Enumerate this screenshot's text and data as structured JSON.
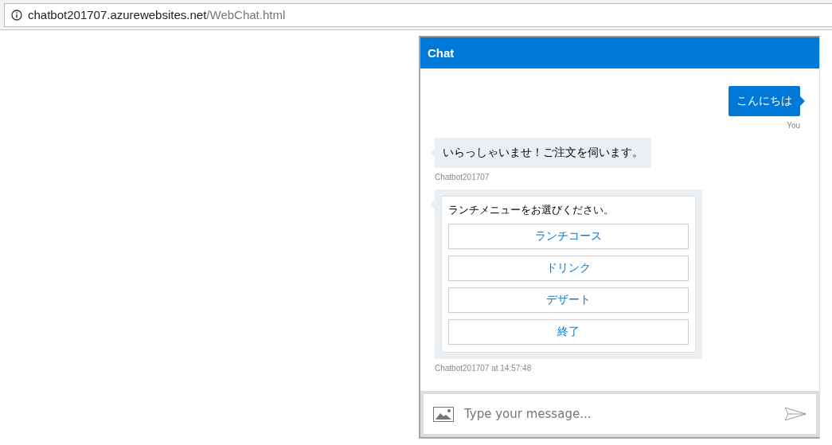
{
  "address_bar": {
    "host": "chatbot201707.azurewebsites.net",
    "path": "/WebChat.html"
  },
  "chat": {
    "title": "Chat",
    "messages": [
      {
        "outgoing": true,
        "kind": "text",
        "text": "こんにちは",
        "meta": "You"
      },
      {
        "outgoing": false,
        "kind": "text",
        "text": "いらっしゃいませ！ご注文を伺います。",
        "meta": "Chatbot201707"
      },
      {
        "outgoing": false,
        "kind": "card",
        "text": "ランチメニューをお選びください。",
        "buttons": [
          "ランチコース",
          "ドリンク",
          "デザート",
          "終了"
        ],
        "meta": "Chatbot201707 at 14:57:48"
      }
    ],
    "input": {
      "placeholder": "Type your message..."
    }
  }
}
